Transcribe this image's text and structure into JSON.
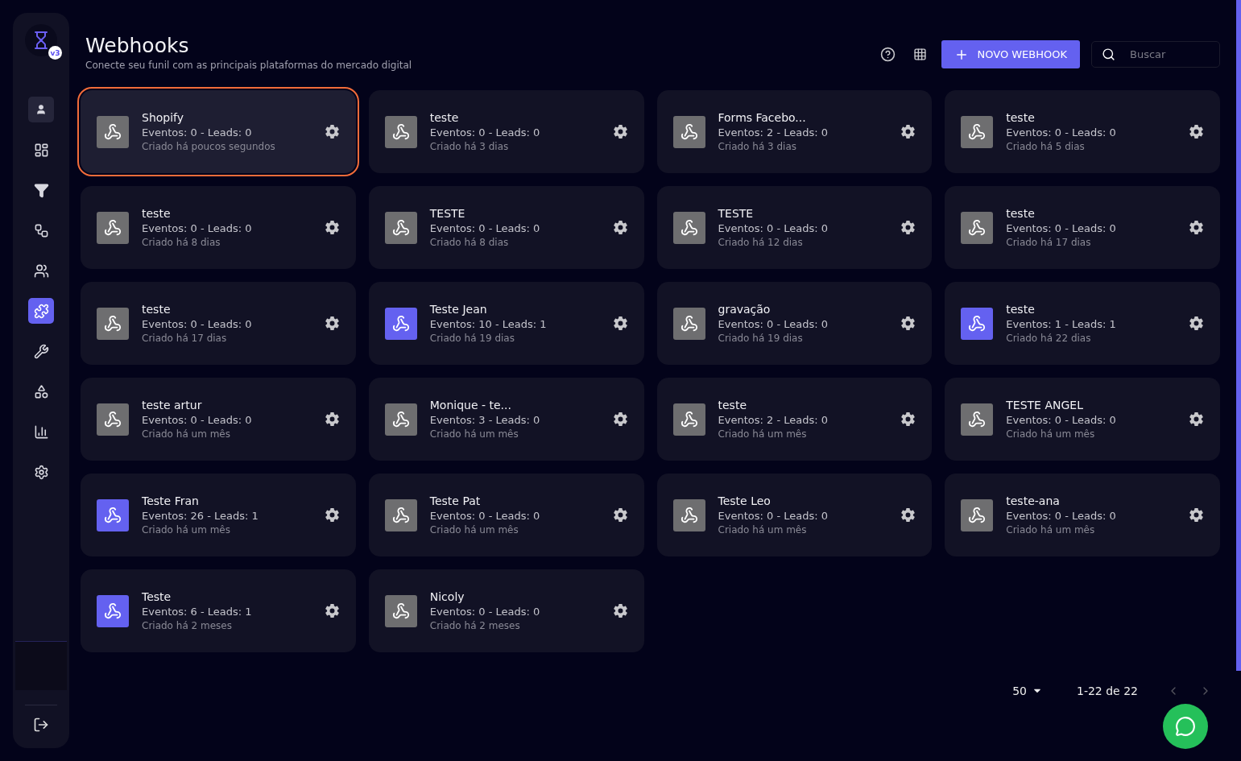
{
  "sidebar": {
    "version_badge": "v3",
    "items": [
      {
        "selected": false
      },
      {
        "selected": false
      },
      {
        "selected": false
      },
      {
        "selected": false
      },
      {
        "selected": false
      },
      {
        "selected": true
      },
      {
        "selected": false
      },
      {
        "selected": false
      },
      {
        "selected": false
      },
      {
        "selected": false
      }
    ]
  },
  "header": {
    "title": "Webhooks",
    "subtitle": "Conecte seu funil com as principais plataformas do mercado digital",
    "new_button": "NOVO WEBHOOK",
    "search": {
      "placeholder": "Buscar"
    }
  },
  "webhooks": [
    {
      "name": "Shopify",
      "stats": "Eventos: 0 - Leads: 0",
      "created": "Criado há poucos segundos",
      "active": false,
      "selected": true
    },
    {
      "name": "teste",
      "stats": "Eventos: 0 - Leads: 0",
      "created": "Criado há 3 dias",
      "active": false,
      "selected": false
    },
    {
      "name": "Forms Facebo...",
      "stats": "Eventos: 2 - Leads: 0",
      "created": "Criado há 3 dias",
      "active": false,
      "selected": false
    },
    {
      "name": "teste",
      "stats": "Eventos: 0 - Leads: 0",
      "created": "Criado há 5 dias",
      "active": false,
      "selected": false
    },
    {
      "name": "teste",
      "stats": "Eventos: 0 - Leads: 0",
      "created": "Criado há 8 dias",
      "active": false,
      "selected": false
    },
    {
      "name": "TESTE",
      "stats": "Eventos: 0 - Leads: 0",
      "created": "Criado há 8 dias",
      "active": false,
      "selected": false
    },
    {
      "name": "TESTE",
      "stats": "Eventos: 0 - Leads: 0",
      "created": "Criado há 12 dias",
      "active": false,
      "selected": false
    },
    {
      "name": "teste",
      "stats": "Eventos: 0 - Leads: 0",
      "created": "Criado há 17 dias",
      "active": false,
      "selected": false
    },
    {
      "name": "teste",
      "stats": "Eventos: 0 - Leads: 0",
      "created": "Criado há 17 dias",
      "active": false,
      "selected": false
    },
    {
      "name": "Teste Jean",
      "stats": "Eventos: 10 - Leads: 1",
      "created": "Criado há 19 dias",
      "active": true,
      "selected": false
    },
    {
      "name": "gravação",
      "stats": "Eventos: 0 - Leads: 0",
      "created": "Criado há 19 dias",
      "active": false,
      "selected": false
    },
    {
      "name": "teste",
      "stats": "Eventos: 1 - Leads: 1",
      "created": "Criado há 22 dias",
      "active": true,
      "selected": false
    },
    {
      "name": "teste artur",
      "stats": "Eventos: 0 - Leads: 0",
      "created": "Criado há um mês",
      "active": false,
      "selected": false
    },
    {
      "name": "Monique - te...",
      "stats": "Eventos: 3 - Leads: 0",
      "created": "Criado há um mês",
      "active": false,
      "selected": false
    },
    {
      "name": "teste",
      "stats": "Eventos: 2 - Leads: 0",
      "created": "Criado há um mês",
      "active": false,
      "selected": false
    },
    {
      "name": "TESTE ANGEL",
      "stats": "Eventos: 0 - Leads: 0",
      "created": "Criado há um mês",
      "active": false,
      "selected": false
    },
    {
      "name": "Teste Fran",
      "stats": "Eventos: 26 - Leads: 1",
      "created": "Criado há um mês",
      "active": true,
      "selected": false
    },
    {
      "name": "Teste Pat",
      "stats": "Eventos: 0 - Leads: 0",
      "created": "Criado há um mês",
      "active": false,
      "selected": false
    },
    {
      "name": "Teste Leo",
      "stats": "Eventos: 0 - Leads: 0",
      "created": "Criado há um mês",
      "active": false,
      "selected": false
    },
    {
      "name": "teste-ana",
      "stats": "Eventos: 0 - Leads: 0",
      "created": "Criado há um mês",
      "active": false,
      "selected": false
    },
    {
      "name": "Teste",
      "stats": "Eventos: 6 - Leads: 1",
      "created": "Criado há 2 meses",
      "active": true,
      "selected": false
    },
    {
      "name": "Nicoly",
      "stats": "Eventos: 0 - Leads: 0",
      "created": "Criado há 2 meses",
      "active": false,
      "selected": false
    }
  ],
  "pagination": {
    "page_size": "50",
    "range": "1-22 de 22"
  }
}
